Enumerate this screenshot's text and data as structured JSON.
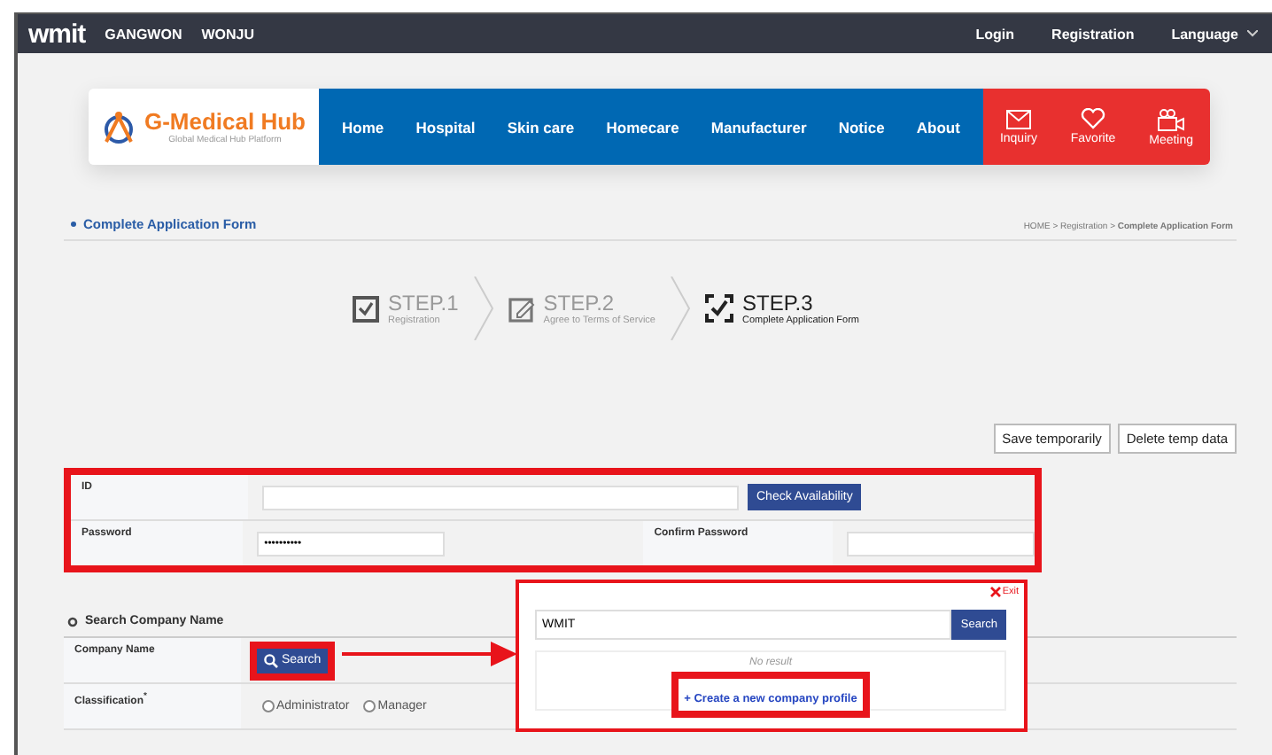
{
  "top_bar": {
    "logo": "wmit",
    "regions": [
      "GANGWON",
      "WONJU"
    ],
    "links": [
      "Login",
      "Registration",
      "Language"
    ]
  },
  "header": {
    "brand": "G-Medical Hub",
    "tagline": "Global Medical Hub Platform",
    "nav": [
      "Home",
      "Hospital",
      "Skin care",
      "Homecare",
      "Manufacturer",
      "Notice",
      "About"
    ],
    "actions": [
      {
        "kind": "mail",
        "label": "Inquiry"
      },
      {
        "kind": "heart",
        "label": "Favorite"
      },
      {
        "kind": "camera",
        "label": "Meeting"
      }
    ]
  },
  "page_title": "Complete Application Form",
  "breadcrumb": "HOME > Registration > **Complete Application Form**",
  "steps": [
    {
      "kind": "check",
      "label": "STEP.1",
      "caption": "Registration",
      "selected": false
    },
    {
      "kind": "edit",
      "label": "STEP.2",
      "caption": "Agree to Terms of Service",
      "selected": false
    },
    {
      "kind": "complete",
      "label": "STEP.3",
      "caption": "Complete Application Form",
      "selected": true
    }
  ],
  "temp_buttons": [
    "Save temporarily",
    "Delete temp data"
  ],
  "account_form": {
    "id_label": "ID",
    "check_button": "Check Availability",
    "password_label": "Password",
    "password_value": "••••••••••",
    "confirm_label": "Confirm Password"
  },
  "company_section": {
    "title": "Search Company Name",
    "company_label": "Company Name",
    "search_button": "Search",
    "classification_label": "Classification$^{*}$",
    "options": [
      {
        "label": "Administrator",
        "selected": false
      },
      {
        "label": "Manager",
        "selected": false
      }
    ]
  },
  "company_popup": {
    "exit": "Exit",
    "query": "WMIT",
    "search_button": "Search",
    "empty": "No result",
    "create_link": "+ Create a new company profile"
  }
}
